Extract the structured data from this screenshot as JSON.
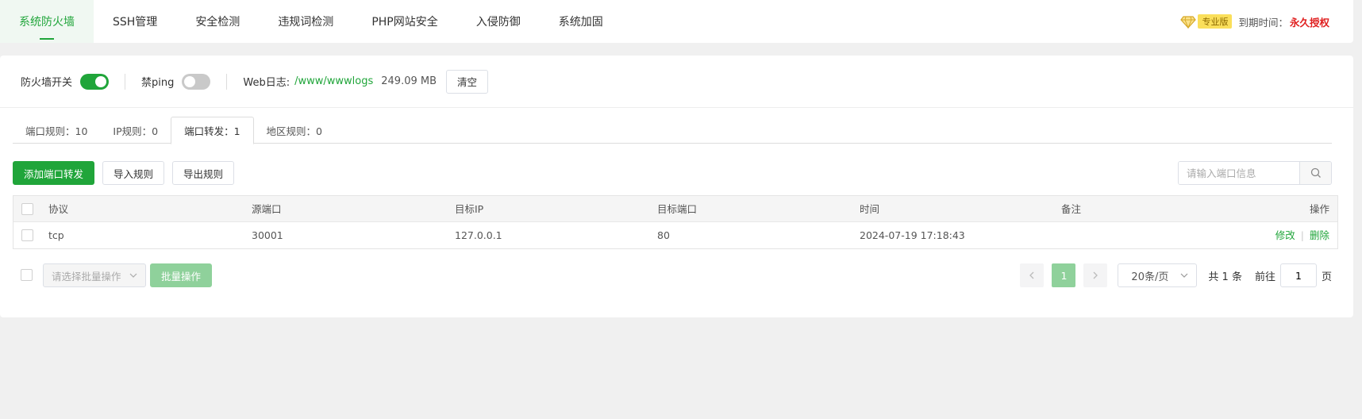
{
  "nav": {
    "tabs": [
      {
        "label": "系统防火墙",
        "active": true
      },
      {
        "label": "SSH管理"
      },
      {
        "label": "安全检测"
      },
      {
        "label": "违规词检测"
      },
      {
        "label": "PHP网站安全"
      },
      {
        "label": "入侵防御"
      },
      {
        "label": "系统加固"
      }
    ],
    "pro_badge": "专业版",
    "expire_label": "到期时间：",
    "expire_value": "永久授权"
  },
  "toolbar": {
    "firewall_label": "防火墙开关",
    "firewall_on": true,
    "ping_label": "禁ping",
    "ping_on": false,
    "weblog_label": "Web日志:",
    "weblog_path": "/www/wwwlogs",
    "weblog_size": "249.09 MB",
    "clear_label": "清空"
  },
  "subtabs": [
    {
      "label": "端口规则：10"
    },
    {
      "label": "IP规则：0"
    },
    {
      "label": "端口转发：1",
      "active": true
    },
    {
      "label": "地区规则：0"
    }
  ],
  "actions": {
    "add": "添加端口转发",
    "import": "导入规则",
    "export": "导出规则",
    "search_placeholder": "请输入端口信息"
  },
  "table": {
    "headers": {
      "protocol": "协议",
      "source_port": "源端口",
      "target_ip": "目标IP",
      "target_port": "目标端口",
      "time": "时间",
      "note": "备注",
      "op": "操作"
    },
    "rows": [
      {
        "protocol": "tcp",
        "source_port": "30001",
        "target_ip": "127.0.0.1",
        "target_port": "80",
        "time": "2024-07-19 17:18:43",
        "note": "",
        "edit": "修改",
        "delete": "删除"
      }
    ]
  },
  "footer": {
    "batch_placeholder": "请选择批量操作",
    "batch_button": "批量操作",
    "current_page": "1",
    "page_size": "20条/页",
    "total": "共 1 条",
    "goto_label": "前往",
    "goto_value": "1",
    "page_unit": "页"
  },
  "colors": {
    "accent": "#20a53a",
    "accent_light": "#8fd19b",
    "danger": "#e02020",
    "badge": "#fadf5b"
  }
}
